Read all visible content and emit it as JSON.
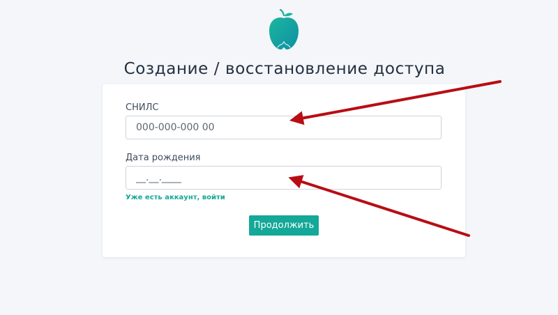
{
  "page": {
    "title": "Создание / восстановление доступа"
  },
  "form": {
    "snils": {
      "label": "СНИЛС",
      "placeholder": "000-000-000 00",
      "value": ""
    },
    "birth_date": {
      "label": "Дата рождения",
      "placeholder": "__.__.____",
      "value": ""
    },
    "login_link": "Уже есть аккаунт, войти",
    "submit_label": "Продолжить"
  },
  "colors": {
    "background": "#f4f6fa",
    "accent": "#14a898",
    "annotation_arrow": "#b80d14"
  },
  "annotations": {
    "arrows": [
      {
        "target": "snils-input",
        "color": "#b80d14"
      },
      {
        "target": "birth-date-input",
        "color": "#b80d14"
      }
    ]
  },
  "icons": {
    "logo": "green-apple-logo-icon"
  }
}
